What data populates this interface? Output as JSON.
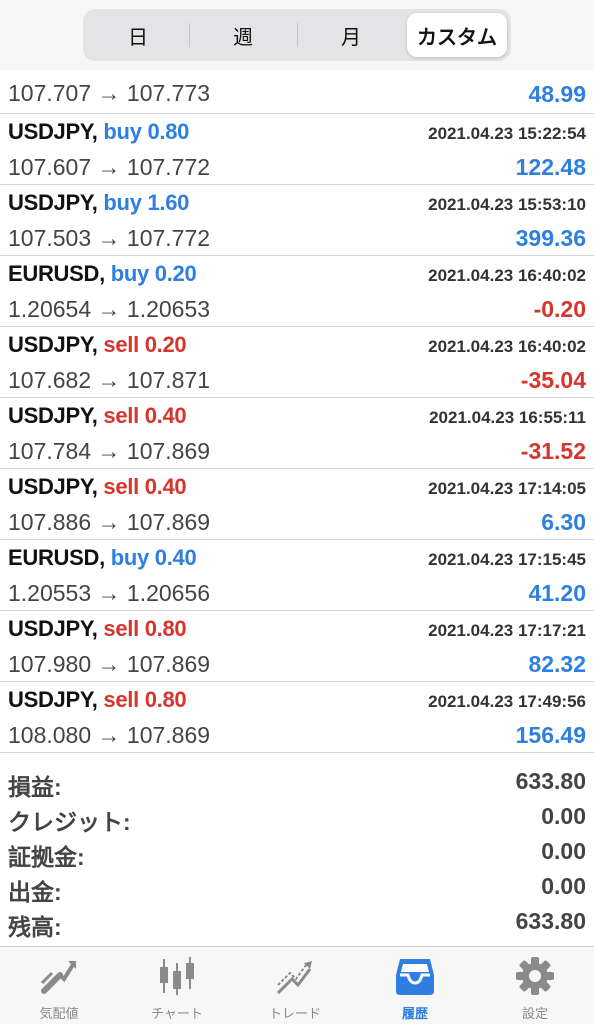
{
  "period_tabs": [
    "日",
    "週",
    "月",
    "カスタム"
  ],
  "partial_row": {
    "price": "107.707 → 107.773",
    "profit": "48.99"
  },
  "trades": [
    {
      "symbol": "USDJPY,",
      "side": "buy",
      "side_text": "buy 0.80",
      "time": "2021.04.23 15:22:54",
      "price": "107.607 → 107.772",
      "profit": "122.48"
    },
    {
      "symbol": "USDJPY,",
      "side": "buy",
      "side_text": "buy 1.60",
      "time": "2021.04.23 15:53:10",
      "price": "107.503 → 107.772",
      "profit": "399.36"
    },
    {
      "symbol": "EURUSD,",
      "side": "buy",
      "side_text": "buy 0.20",
      "time": "2021.04.23 16:40:02",
      "price": "1.20654 → 1.20653",
      "profit": "-0.20"
    },
    {
      "symbol": "USDJPY,",
      "side": "sell",
      "side_text": "sell 0.20",
      "time": "2021.04.23 16:40:02",
      "price": "107.682 → 107.871",
      "profit": "-35.04"
    },
    {
      "symbol": "USDJPY,",
      "side": "sell",
      "side_text": "sell 0.40",
      "time": "2021.04.23 16:55:11",
      "price": "107.784 → 107.869",
      "profit": "-31.52"
    },
    {
      "symbol": "USDJPY,",
      "side": "sell",
      "side_text": "sell 0.40",
      "time": "2021.04.23 17:14:05",
      "price": "107.886 → 107.869",
      "profit": "6.30"
    },
    {
      "symbol": "EURUSD,",
      "side": "buy",
      "side_text": "buy 0.40",
      "time": "2021.04.23 17:15:45",
      "price": "1.20553 → 1.20656",
      "profit": "41.20"
    },
    {
      "symbol": "USDJPY,",
      "side": "sell",
      "side_text": "sell 0.80",
      "time": "2021.04.23 17:17:21",
      "price": "107.980 → 107.869",
      "profit": "82.32"
    },
    {
      "symbol": "USDJPY,",
      "side": "sell",
      "side_text": "sell 0.80",
      "time": "2021.04.23 17:49:56",
      "price": "108.080 → 107.869",
      "profit": "156.49"
    }
  ],
  "summary": [
    {
      "label": "損益:",
      "value": "633.80"
    },
    {
      "label": "クレジット:",
      "value": "0.00"
    },
    {
      "label": "証拠金:",
      "value": "0.00"
    },
    {
      "label": "出金:",
      "value": "0.00"
    },
    {
      "label": "残高:",
      "value": "633.80"
    }
  ],
  "bottom_tabs": [
    {
      "label": "気配値",
      "icon": "quotes-icon"
    },
    {
      "label": "チャート",
      "icon": "chart-icon"
    },
    {
      "label": "トレード",
      "icon": "trade-icon"
    },
    {
      "label": "履歴",
      "icon": "history-icon",
      "active": true
    },
    {
      "label": "設定",
      "icon": "settings-icon"
    }
  ],
  "colors": {
    "buy": "#2e7fe0",
    "sell": "#d6352b",
    "profit_pos": "#2e7fe0",
    "profit_neg": "#d6352b",
    "tab_active": "#2e7fe0",
    "tab_inactive": "#8a8a8a"
  }
}
